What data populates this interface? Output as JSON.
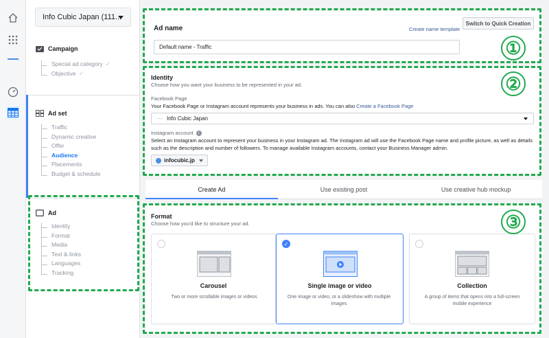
{
  "account": {
    "name": "Info Cubic Japan (111..."
  },
  "nav": {
    "campaign": {
      "title": "Campaign",
      "items": [
        {
          "label": "Special ad category"
        },
        {
          "label": "Objective"
        }
      ]
    },
    "adset": {
      "title": "Ad set",
      "items": [
        {
          "label": "Traffic"
        },
        {
          "label": "Dynamic creative"
        },
        {
          "label": "Offer"
        },
        {
          "label": "Audience"
        },
        {
          "label": "Placements"
        },
        {
          "label": "Budget & schedule"
        }
      ]
    },
    "ad": {
      "title": "Ad",
      "items": [
        {
          "label": "Identity"
        },
        {
          "label": "Format"
        },
        {
          "label": "Media"
        },
        {
          "label": "Text & links"
        },
        {
          "label": "Languages"
        },
        {
          "label": "Tracking"
        }
      ]
    }
  },
  "adname": {
    "title": "Ad name",
    "template_link": "Create name template",
    "switch_button": "Switch to Quick Creation",
    "value": "Default name - Traffic"
  },
  "identity": {
    "title": "Identity",
    "subtitle": "Choose how you want your business to be represented in your ad.",
    "fb_label": "Facebook Page",
    "fb_help": "Your Facebook Page or Instagram account represents your business in ads. You can also",
    "fb_help_link": "Create a Facebook Page",
    "fb_value": "Info Cubic Japan",
    "ig_label": "Instagram account",
    "ig_help": "Select an Instagram account to represent your business in your Instagram ad. The Instagram ad will use the Facebook Page name and profile picture, as well as details such as the description and number of followers. To manage available Instagram accounts, contact your Business Manager admin.",
    "ig_value": "infocubic.jp"
  },
  "tabs": [
    {
      "label": "Create Ad"
    },
    {
      "label": "Use existing post"
    },
    {
      "label": "Use creative hub mockup"
    }
  ],
  "format": {
    "title": "Format",
    "subtitle": "Choose how you'd like to structure your ad.",
    "options": [
      {
        "title": "Carousel",
        "desc": "Two or more scrollable images or videos"
      },
      {
        "title": "Single image or video",
        "desc": "One image or video, or a slideshow with multiple images"
      },
      {
        "title": "Collection",
        "desc": "A group of items that opens into a full-screen mobile experience"
      }
    ]
  },
  "annotations": {
    "one": "①",
    "two": "②",
    "three": "③"
  },
  "colors": {
    "accent": "#4080ff",
    "annotation": "#20a94d",
    "link": "#385898"
  }
}
